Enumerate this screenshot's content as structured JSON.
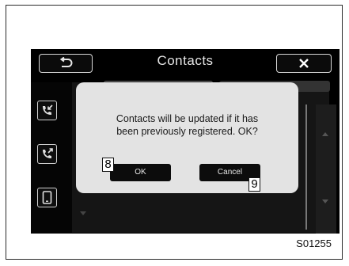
{
  "screen": {
    "title": "Contacts",
    "back_icon": "back-arrow-icon",
    "close_icon": "close-x-icon"
  },
  "sidebar": {
    "items": [
      {
        "icon": "incoming-call-icon"
      },
      {
        "icon": "outgoing-call-icon"
      },
      {
        "icon": "phone-device-icon"
      }
    ]
  },
  "dialog": {
    "message_line1": "Contacts will be updated if it has",
    "message_line2": "been previously registered.  OK?",
    "ok_label": "OK",
    "cancel_label": "Cancel"
  },
  "callouts": {
    "ok": "8",
    "cancel": "9"
  },
  "figure_id": "S01255",
  "colors": {
    "screen_bg": "#000000",
    "dialog_bg": "#e3e3e3",
    "button_bg": "#0c0c0c",
    "button_text": "#e6e6e6"
  }
}
